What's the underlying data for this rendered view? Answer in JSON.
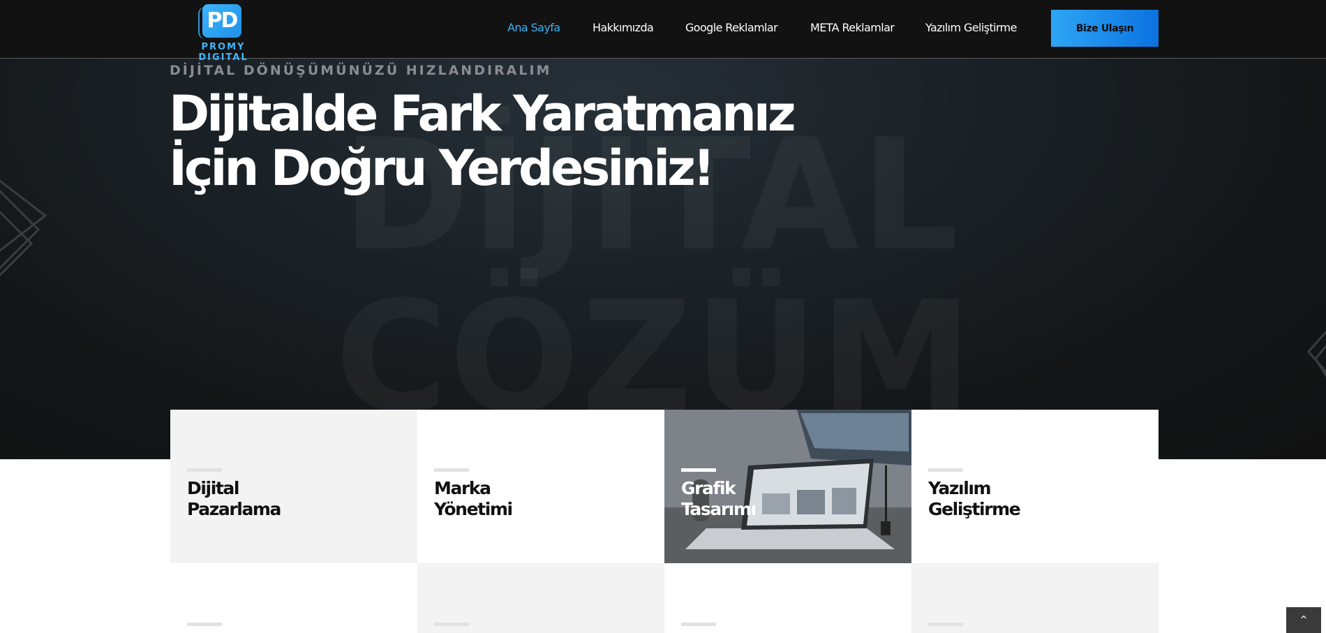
{
  "brand": {
    "logo_mark": "PD",
    "logo_text": "PROMY DIGITAL",
    "accent": "#3db6ff"
  },
  "nav": {
    "items": [
      {
        "label": "Ana Sayfa",
        "active": true
      },
      {
        "label": "Hakkımızda",
        "active": false
      },
      {
        "label": "Google Reklamlar",
        "active": false
      },
      {
        "label": "META Reklamlar",
        "active": false
      },
      {
        "label": "Yazılım Geliştirme",
        "active": false
      }
    ],
    "cta_label": "Bize Ulaşın"
  },
  "hero": {
    "eyebrow": "DİJİTAL DÖNÜŞÜMÜNÜZÜ HIZLANDIRALIM",
    "headline_line1": "Dijitalde Fark Yaratmanız",
    "headline_line2": "İçin Doğru Yerdesiniz!",
    "background_word1": "DİJİTAL",
    "background_word2": "ÇÖZÜM"
  },
  "services": {
    "row1": [
      {
        "line1": "Dijital",
        "line2": "Pazarlama",
        "style": "light"
      },
      {
        "line1": "Marka",
        "line2": "Yönetimi",
        "style": "white"
      },
      {
        "line1": "Grafik",
        "line2": "Tasarımı",
        "style": "photo"
      },
      {
        "line1": "Yazılım",
        "line2": "Geliştirme",
        "style": "white"
      }
    ]
  },
  "scroll_top_icon": "chevron-up-icon"
}
